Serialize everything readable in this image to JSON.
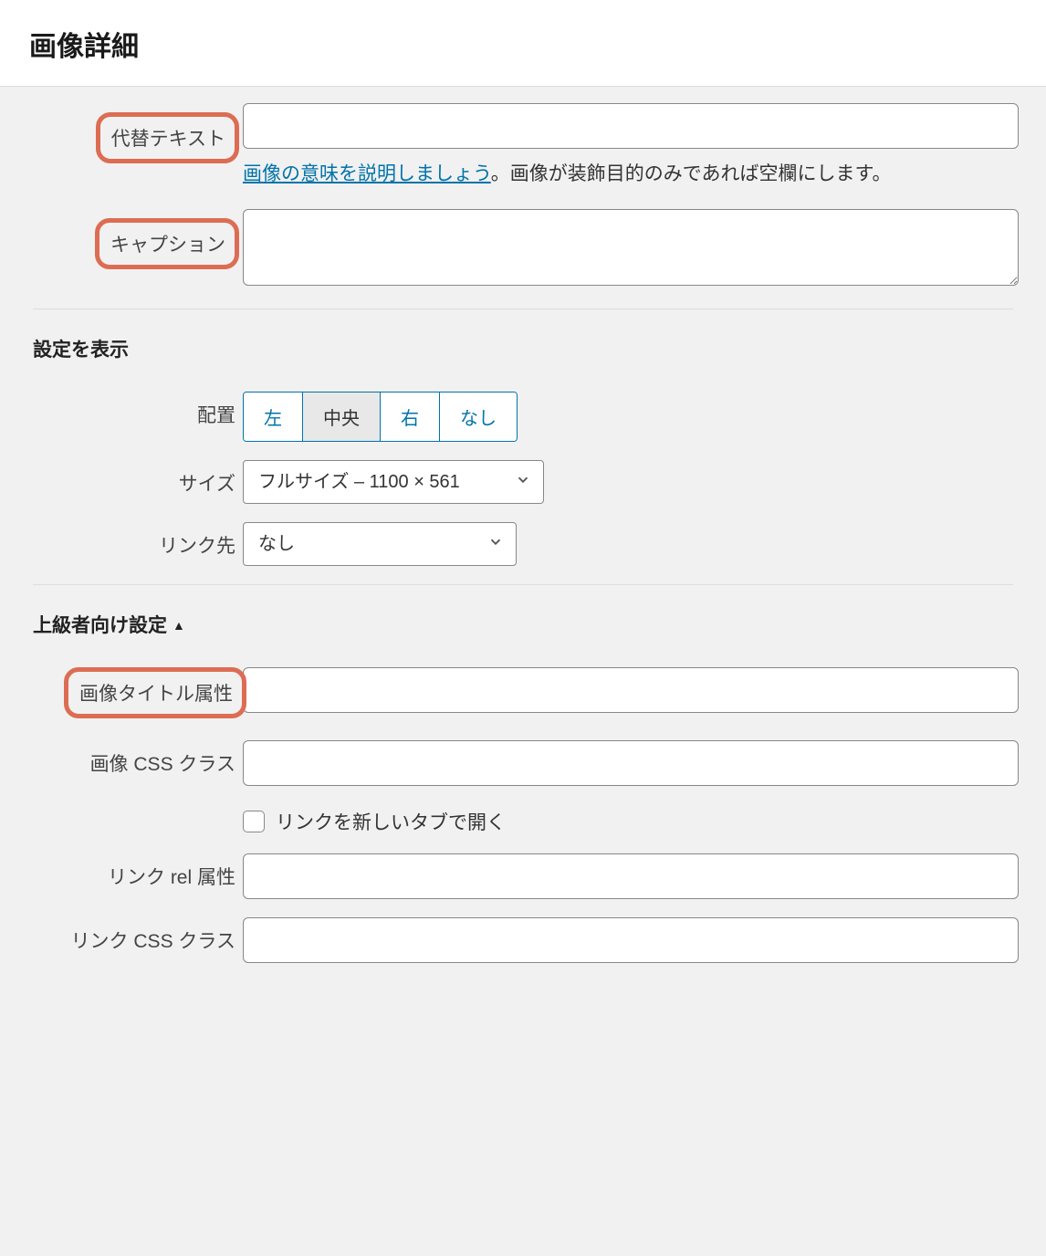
{
  "header": {
    "title": "画像詳細"
  },
  "fields": {
    "alt": {
      "label": "代替テキスト",
      "value": "",
      "hint_link": "画像の意味を説明しましょう",
      "hint_rest": "。画像が装飾目的のみであれば空欄にします。"
    },
    "caption": {
      "label": "キャプション",
      "value": ""
    }
  },
  "display": {
    "section_title": "設定を表示",
    "align": {
      "label": "配置",
      "options": {
        "left": "左",
        "center": "中央",
        "right": "右",
        "none": "なし"
      },
      "selected": "center"
    },
    "size": {
      "label": "サイズ",
      "selected": "フルサイズ – 1100 × 561"
    },
    "link": {
      "label": "リンク先",
      "selected": "なし"
    }
  },
  "advanced": {
    "section_title": "上級者向け設定",
    "image_title": {
      "label": "画像タイトル属性",
      "value": ""
    },
    "image_css": {
      "label": "画像 CSS クラス",
      "value": ""
    },
    "open_new_tab": {
      "label": "リンクを新しいタブで開く",
      "checked": false
    },
    "link_rel": {
      "label": "リンク rel 属性",
      "value": ""
    },
    "link_css": {
      "label": "リンク CSS クラス",
      "value": ""
    }
  }
}
